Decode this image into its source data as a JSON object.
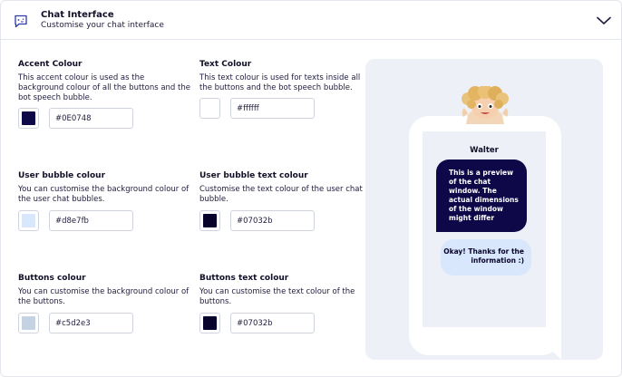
{
  "header": {
    "title": "Chat Interface",
    "subtitle": "Customise your chat interface",
    "icon": "chat-bubble-icon",
    "toggle_icon": "chevron-down-icon"
  },
  "fields": {
    "accent": {
      "label": "Accent Colour",
      "description": "This accent colour is used as the background colour of all the buttons and the bot speech bubble.",
      "value": "#0E0748",
      "swatch": "#0e0748"
    },
    "text": {
      "label": "Text Colour",
      "description": "This text colour is used for texts inside all the buttons and the bot speech bubble.",
      "value": "#ffffff",
      "swatch": "#ffffff"
    },
    "user_bubble": {
      "label": "User bubble colour",
      "description": "You can customise the background colour of the user chat bubbles.",
      "value": "#d8e7fb",
      "swatch": "#d8e7fb"
    },
    "user_bubble_text": {
      "label": "User bubble text colour",
      "description": "Customise the text colour of the user chat bubble.",
      "value": "#07032b",
      "swatch": "#07032b"
    },
    "buttons": {
      "label": "Buttons colour",
      "description": "You can customise the background colour of the buttons.",
      "value": "#c5d2e3",
      "swatch": "#c5d2e3"
    },
    "buttons_text": {
      "label": "Buttons text colour",
      "description": "You can customise the text colour of the buttons.",
      "value": "#07032b",
      "swatch": "#07032b"
    }
  },
  "preview": {
    "bot_name": "Walter",
    "bot_message": "This is a preview of the chat window. The actual dimensions of the window might differ",
    "user_message": "Okay! Thanks for the information :)",
    "bot_bubble_color": "#0e0748",
    "bot_text_color": "#ffffff",
    "user_bubble_color": "#d8e7fb",
    "user_text_color": "#07032b"
  }
}
